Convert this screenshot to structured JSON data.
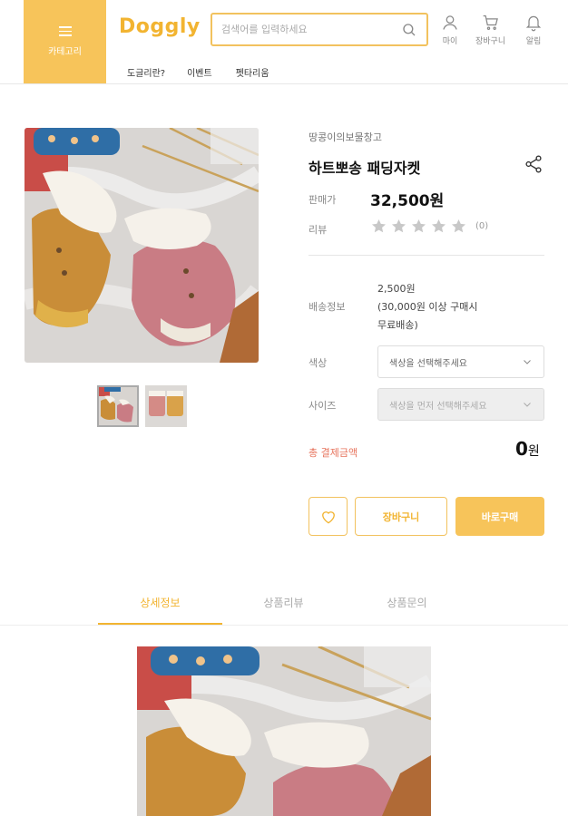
{
  "header": {
    "category_label": "카테고리",
    "logo": "Doggly",
    "search_placeholder": "검색어를 입력하세요",
    "utils": {
      "my": "마이",
      "cart": "장바구니",
      "alarm": "알림"
    },
    "nav": [
      "도글리란?",
      "이벤트",
      "펫타리움"
    ]
  },
  "product": {
    "brand": "땅콩이의보물창고",
    "title": "하트뽀송 패딩자켓",
    "price_label": "판매가",
    "price": "32,500원",
    "review_label": "리뷰",
    "rating": 0,
    "review_count": "(0)",
    "shipping_label": "배송정보",
    "shipping_fee": "2,500원",
    "shipping_note_1": "(30,000원 이상 구매시",
    "shipping_note_2": "무료배송)",
    "color_label": "색상",
    "color_placeholder": "색상을 선택해주세요",
    "size_label": "사이즈",
    "size_placeholder": "색상을 먼저 선택해주세요",
    "total_label": "총 결제금액",
    "total_value": "0",
    "total_unit": "원",
    "cart_button": "장바구니",
    "buy_button": "바로구매"
  },
  "tabs": [
    "상세정보",
    "상품리뷰",
    "상품문의"
  ],
  "colors": {
    "accent": "#f7c45a",
    "accent_text": "#f2b431",
    "total_label": "#e7745d"
  }
}
